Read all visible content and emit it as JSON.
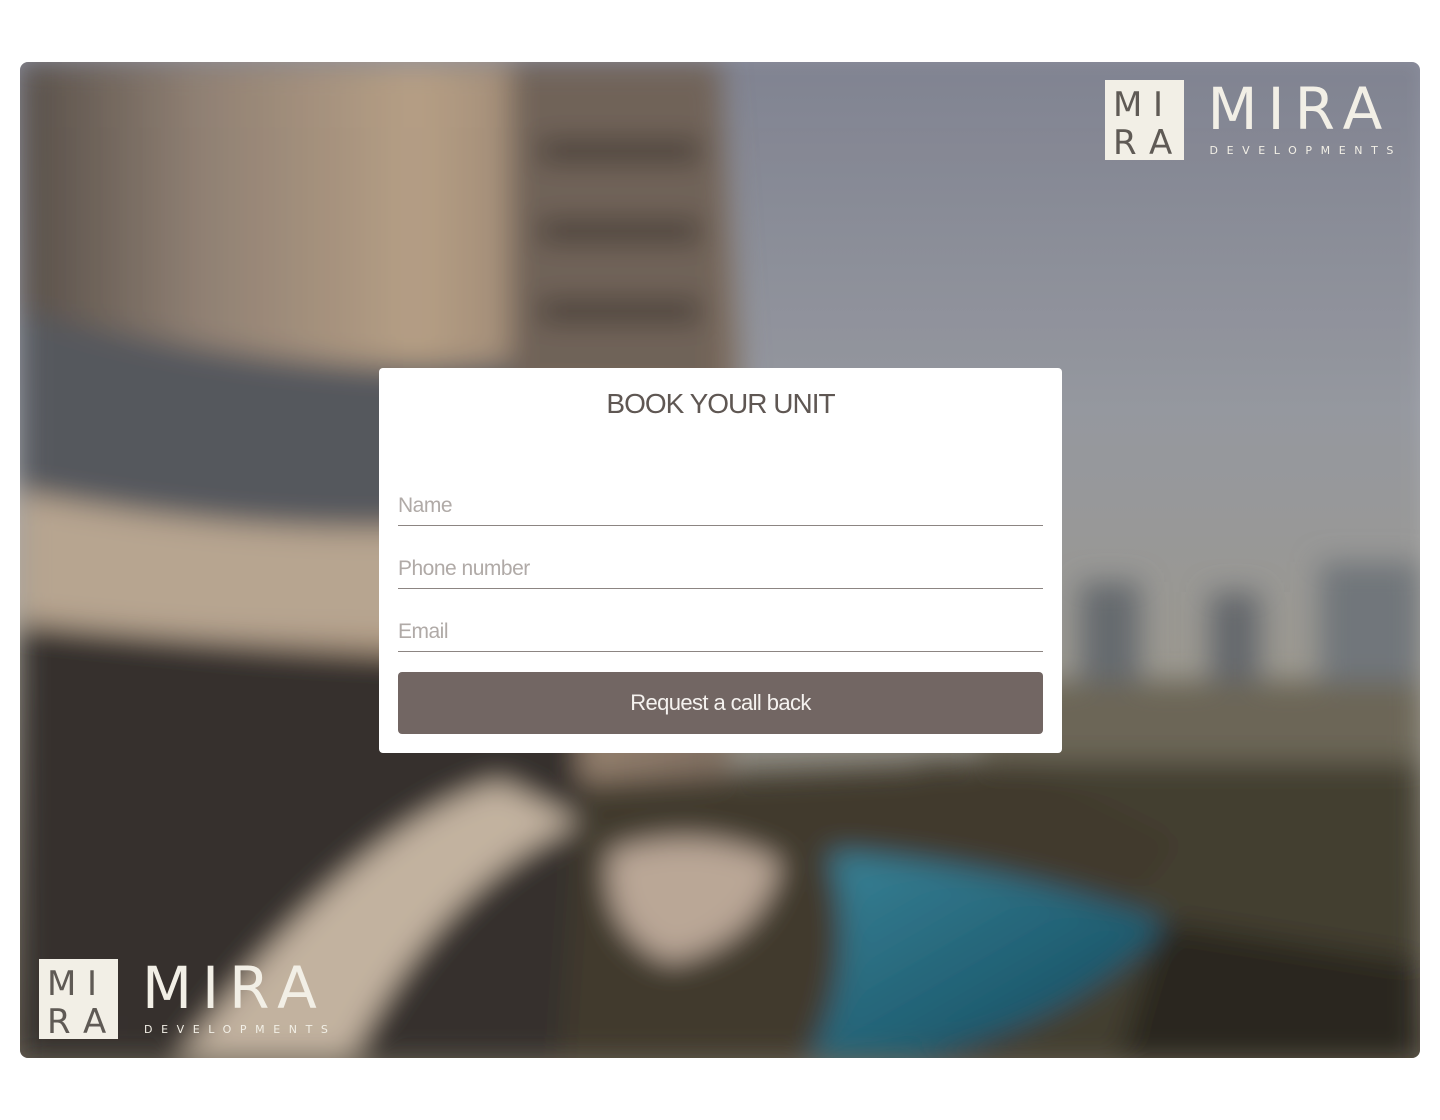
{
  "brand": {
    "mark_letters": [
      "M",
      "I",
      "R",
      "A"
    ],
    "name": "MIRA",
    "subtitle": "DEVELOPMENTS",
    "color": "#f2efe6"
  },
  "form": {
    "title": "BOOK YOUR UNIT",
    "name_placeholder": "Name",
    "phone_placeholder": "Phone number",
    "email_placeholder": "Email",
    "submit_label": "Request a call back",
    "button_color": "#726663"
  }
}
